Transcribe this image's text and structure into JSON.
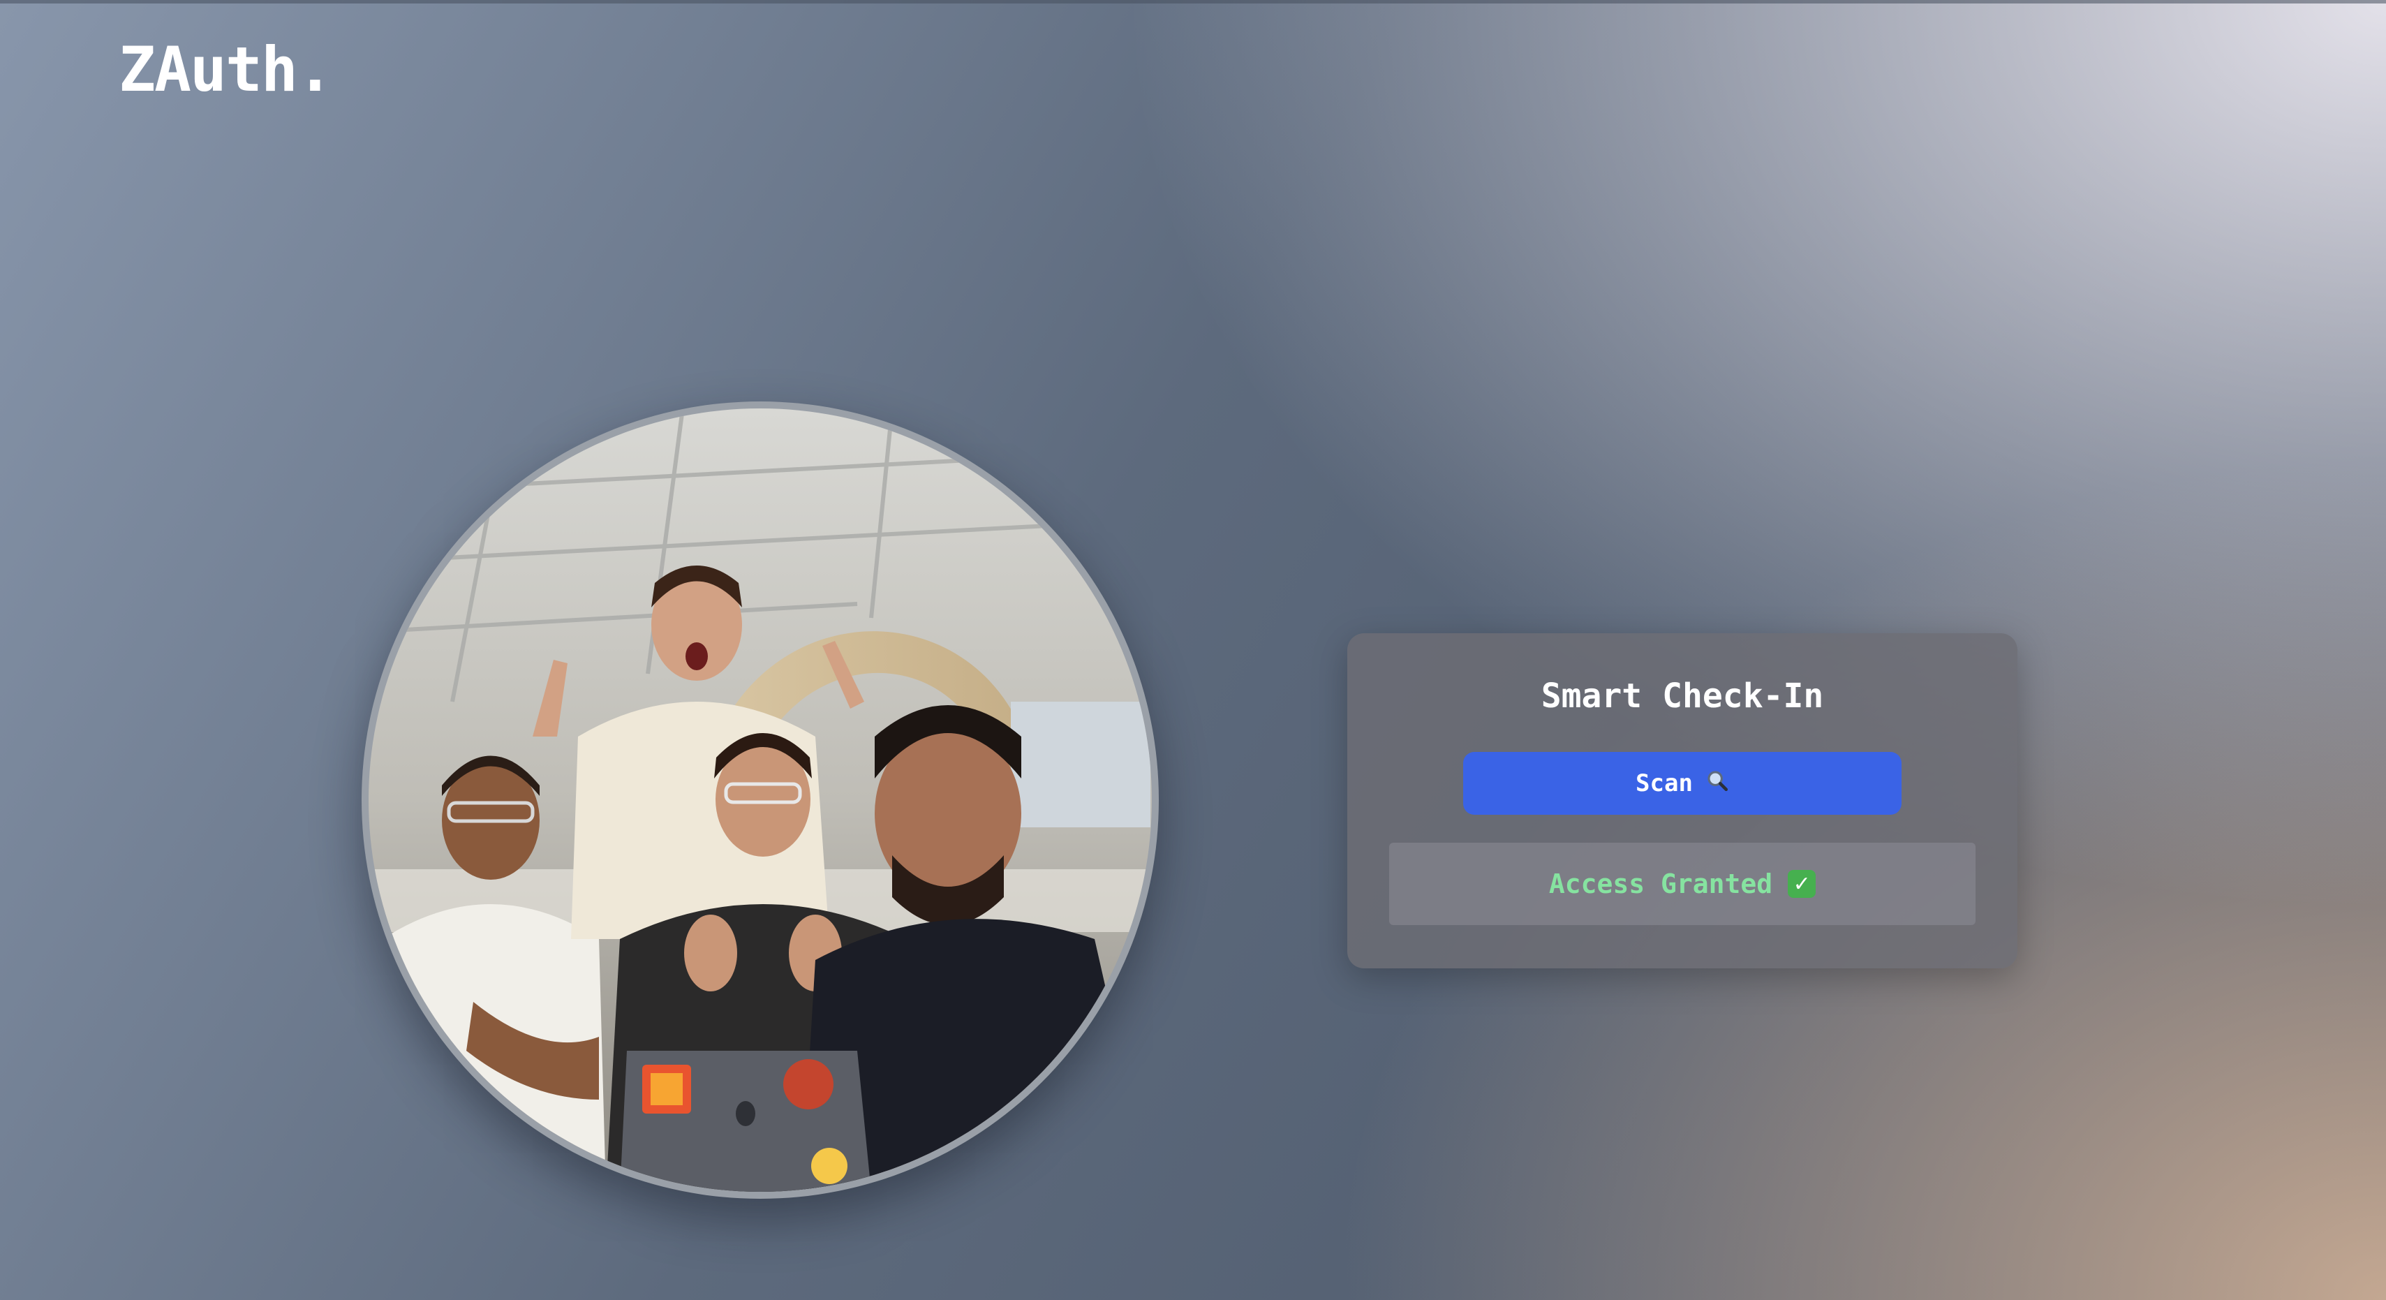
{
  "brand": {
    "logo_text": "ZAuth."
  },
  "camera": {
    "description_icon": "camera-feed"
  },
  "checkin": {
    "title": "Smart Check-In",
    "scan_label": "Scan",
    "scan_icon": "search-icon",
    "status_text": "Access Granted",
    "status_icon": "check-icon"
  },
  "colors": {
    "accent": "#3a63e6",
    "success_text": "#86e3a0",
    "success_icon": "#46b04f"
  }
}
